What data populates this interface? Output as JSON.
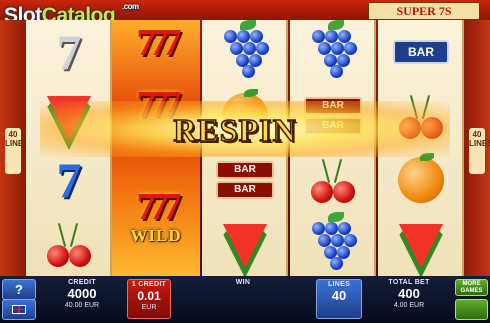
{
  "watermark": {
    "part1": "Slot",
    "part2": "Catalog",
    "suffix": ".com"
  },
  "logo": {
    "text": "SUPER 7S"
  },
  "side": {
    "label_left": "40 LINES",
    "label_right": "40 LINES"
  },
  "banner": {
    "text": "RESPIN"
  },
  "wild": {
    "text": "WILD"
  },
  "symbols": {
    "bar": "BAR"
  },
  "bottom": {
    "help_label": "?",
    "credit_label": "CREDIT",
    "credit_value": "4000",
    "credit_sub": "40.00 EUR",
    "coin_label": "1 CREDIT",
    "coin_value": "0.01",
    "coin_sub": "EUR",
    "win_label": "WIN",
    "win_value": "",
    "lines_label": "LINES",
    "lines_value": "40",
    "totalbet_label": "TOTAL BET",
    "totalbet_value": "400",
    "totalbet_sub": "4.00 EUR",
    "moregames_label": "MORE GAMES"
  },
  "colors": {
    "accent_red": "#c91b0e",
    "accent_blue": "#1d3e8c",
    "accent_green": "#2c6b0d",
    "banner_gold": "#ffd94a"
  }
}
